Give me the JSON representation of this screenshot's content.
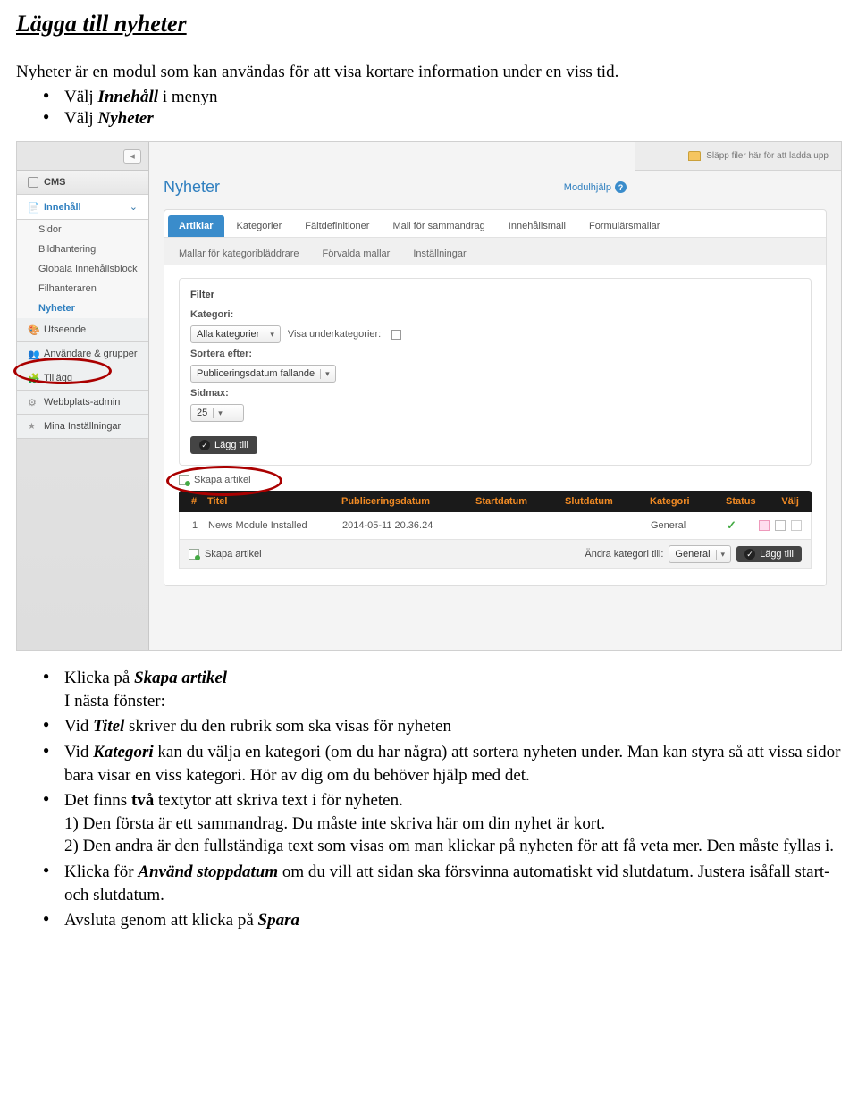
{
  "doc": {
    "heading": "Lägga till nyheter",
    "intro": "Nyheter är en modul som kan användas för att visa kortare information under en viss tid.",
    "top_bullets": [
      {
        "pre": "Välj ",
        "em": "Innehåll",
        "post": " i menyn"
      },
      {
        "pre": "Välj ",
        "em": "Nyheter",
        "post": ""
      }
    ],
    "bottom_bullets": {
      "b1_pre": "Klicka på ",
      "b1_em": "Skapa artikel",
      "b1_line2": "I nästa fönster:",
      "b2_pre": "Vid ",
      "b2_em": "Titel",
      "b2_post": " skriver du den rubrik som ska visas för nyheten",
      "b3_pre": "Vid ",
      "b3_em": "Kategori",
      "b3_post": " kan du välja en kategori (om du har några) att sortera nyheten under. Man kan styra så att vissa sidor bara visar en viss kategori. Hör av dig om du behöver hjälp med det.",
      "b4_pre": "Det finns ",
      "b4_em": "två",
      "b4_post": " textytor att skriva text i för nyheten.",
      "b4_l1": "1) Den första är ett sammandrag. Du måste inte skriva här om din nyhet är kort.",
      "b4_l2": "2) Den andra är den fullständiga text som visas om man klickar på nyheten för att få veta mer. Den måste fyllas i.",
      "b5_pre": "Klicka för ",
      "b5_em": "Använd stoppdatum",
      "b5_post": " om du vill att sidan ska försvinna automatiskt vid slutdatum. Justera isåfall start- och slutdatum.",
      "b6_pre": "Avsluta genom att klicka på ",
      "b6_em": "Spara"
    }
  },
  "ui": {
    "dropzone": "Släpp filer här för att ladda upp",
    "page_title": "Nyheter",
    "mod_help": "Modulhjälp",
    "sidebar": {
      "cms": "CMS",
      "innehall": "Innehåll",
      "subs": [
        "Sidor",
        "Bildhantering",
        "Globala Innehållsblock",
        "Filhanteraren",
        "Nyheter"
      ],
      "utseende": "Utseende",
      "anvandare": "Användare & grupper",
      "tillagg": "Tillägg",
      "webbplats": "Webbplats-admin",
      "mina": "Mina Inställningar"
    },
    "tabs_row1": [
      "Artiklar",
      "Kategorier",
      "Fältdefinitioner",
      "Mall för sammandrag",
      "Innehållsmall",
      "Formulärsmallar"
    ],
    "tabs_row2": [
      "Mallar för kategoribläddrare",
      "Förvalda mallar",
      "Inställningar"
    ],
    "filter": {
      "title": "Filter",
      "kategori_label": "Kategori:",
      "kategori_value": "Alla kategorier",
      "subcat_label": "Visa underkategorier:",
      "sort_label": "Sortera efter:",
      "sort_value": "Publiceringsdatum fallande",
      "sidmax_label": "Sidmax:",
      "sidmax_value": "25",
      "add_btn": "Lägg till"
    },
    "skapa": "Skapa artikel",
    "table": {
      "hdr_num": "#",
      "hdr_title": "Titel",
      "hdr_pub": "Publiceringsdatum",
      "hdr_start": "Startdatum",
      "hdr_slut": "Slutdatum",
      "hdr_kat": "Kategori",
      "hdr_status": "Status",
      "hdr_valj": "Välj",
      "row_num": "1",
      "row_title": "News Module Installed",
      "row_pub": "2014-05-11 20.36.24",
      "row_kat": "General"
    },
    "footer": {
      "skapa": "Skapa artikel",
      "change_cat": "Ändra kategori till:",
      "cat_value": "General",
      "add": "Lägg till"
    }
  }
}
